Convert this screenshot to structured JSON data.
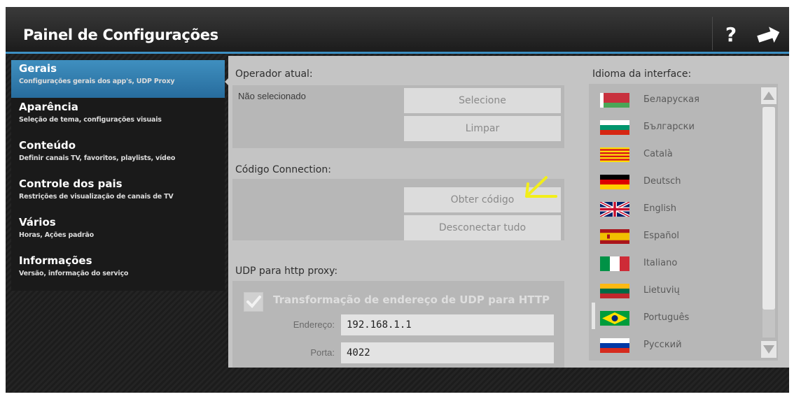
{
  "header": {
    "title": "Painel de Configurações",
    "help_icon": "?"
  },
  "sidebar": {
    "items": [
      {
        "label": "Gerais",
        "sub": "Configurações gerais dos app's, UDP Proxy"
      },
      {
        "label": "Aparência",
        "sub": "Seleção de tema, configurações visuais"
      },
      {
        "label": "Conteúdo",
        "sub": "Definir canais TV, favoritos, playlists, vídeo"
      },
      {
        "label": "Controle dos pais",
        "sub": "Restrições de visualização de canais de TV"
      },
      {
        "label": "Vários",
        "sub": "Horas, Ações padrão"
      },
      {
        "label": "Informações",
        "sub": "Versão, informação do serviço"
      }
    ]
  },
  "operator": {
    "title": "Operador atual:",
    "status": "Não selecionado",
    "select_button": "Selecione",
    "clear_button": "Limpar"
  },
  "connection": {
    "title": "Código Connection:",
    "get_code_button": "Obter código",
    "disconnect_button": "Desconectar tudo"
  },
  "udp": {
    "title": "UDP para http proxy:",
    "checkbox_label": "Transformação de endereço de UDP para HTTP",
    "checked": true,
    "address_label": "Endereço:",
    "address_value": "192.168.1.1",
    "port_label": "Porta:",
    "port_value": "4022"
  },
  "language": {
    "title": "Idioma da interface:",
    "selected": "Português",
    "items": [
      {
        "name": "Беларуская",
        "flag": "by"
      },
      {
        "name": "Български",
        "flag": "bg"
      },
      {
        "name": "Català",
        "flag": "ca"
      },
      {
        "name": "Deutsch",
        "flag": "de"
      },
      {
        "name": "English",
        "flag": "gb"
      },
      {
        "name": "Español",
        "flag": "es"
      },
      {
        "name": "Italiano",
        "flag": "it"
      },
      {
        "name": "Lietuvių",
        "flag": "lt"
      },
      {
        "name": "Português",
        "flag": "br"
      },
      {
        "name": "Русский",
        "flag": "ru"
      }
    ]
  },
  "colors": {
    "accent": "#3d8fc2",
    "active_nav": "#2f7db0",
    "annotation_arrow": "#f2ee1a",
    "panel": "#c4c4c4"
  },
  "icons": {
    "help": "question-mark-icon",
    "forward": "forward-arrow-icon",
    "checkbox": "checkmark-icon",
    "scroll_up": "triangle-up-icon",
    "scroll_down": "triangle-down-icon",
    "annotation": "yellow-arrow-icon"
  }
}
